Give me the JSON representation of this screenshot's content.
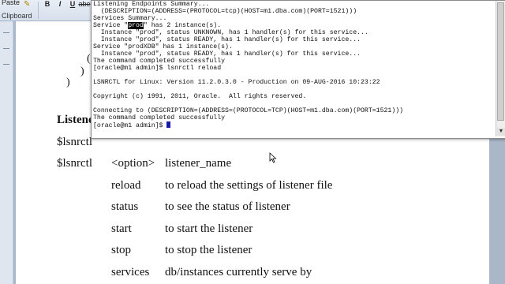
{
  "ribbon": {
    "paste_label": "Paste",
    "clipboard_label": "Clipboard",
    "bold_label": "B",
    "italic_label": "I",
    "underline_label": "U",
    "strike_label": "abe"
  },
  "terminal": {
    "lines": [
      "Listening Endpoints Summary...",
      "  (DESCRIPTION=(ADDRESS=(PROTOCOL=tcp)(HOST=m1.dba.com)(PORT=1521)))",
      "Services Summary...",
      "Service \"prod\" has 2 instance(s).",
      "  Instance \"prod\", status UNKNOWN, has 1 handler(s) for this service...",
      "  Instance \"prod\", status READY, has 1 handler(s) for this service...",
      "Service \"prodXDB\" has 1 instance(s).",
      "  Instance \"prod\", status READY, has 1 handler(s) for this service...",
      "The command completed successfully",
      "[oracle@m1 admin]$ lsnrctl reload",
      "",
      "LSNRCTL for Linux: Version 11.2.0.3.0 - Production on 09-AUG-2016 10:23:22",
      "",
      "Copyright (c) 1991, 2011, Oracle.  All rights reserved.",
      "",
      "Connecting to (DESCRIPTION=(ADDRESS=(PROTOCOL=TCP)(HOST=m1.dba.com)(PORT=1521)))",
      "The command completed successfully",
      "[oracle@m1 admin]$ "
    ],
    "highlighted_line_index": 3,
    "highlight_prefix": "Service \"",
    "highlight_text": "prod",
    "highlight_suffix": "\" has 2 instance(s).",
    "cursor_color": "#1a1aaa"
  },
  "document": {
    "paren_open": "(",
    "paren_close1": ")",
    "paren_close2": ")",
    "heading_fragment": "Listene",
    "cmd_line_1": "$lsnrctl",
    "cmd_line_2": "$lsnrctl",
    "syntax_option": "<option>",
    "syntax_name": "listener_name",
    "options": [
      {
        "cmd": "reload",
        "desc": "to reload the settings of listener file"
      },
      {
        "cmd": "status",
        "desc": "to see the status of listener"
      },
      {
        "cmd": "start",
        "desc": "to start the listener"
      },
      {
        "cmd": "stop",
        "desc": "to stop the listener"
      },
      {
        "cmd": "services",
        "desc": "db/instances currently serve by"
      }
    ]
  },
  "colors": {
    "desktop_bg": "#a9b7c9",
    "ribbon_bg": "#dbe3ef",
    "page_bg": "#ffffff",
    "terminal_bg": "#ffffff"
  }
}
